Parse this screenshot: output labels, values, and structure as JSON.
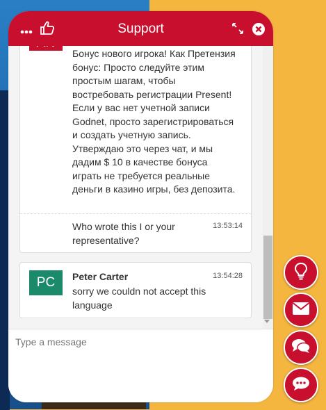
{
  "header": {
    "title": "Support"
  },
  "messages": [
    {
      "avatar": "AN",
      "avatar_color": "#c8102e",
      "text": "Бонус нового игрока! Как Претензия бонус: Просто следуйте этим простым шагам, чтобы востребовать регистрации Present! Если у вас нет учетной записи Godnet, просто зарегистрироваться и создать учетную запись. Утверждаю это через чат, и мы дадим $ 10 в качестве бонуса играть не требуется реальные деньги в казино игры, без депозита.",
      "followup_text": "Who wrote this I or your representative?",
      "followup_time": "13:53:14"
    },
    {
      "avatar": "PC",
      "avatar_color": "#1b8a6b",
      "name": "Peter Carter",
      "text": "sorry we couldn not accept this language",
      "time": "13:54:28"
    }
  ],
  "composer": {
    "placeholder": "Type a message"
  },
  "fabs": [
    "lightbulb-icon",
    "envelope-icon",
    "chat-bubbles-icon",
    "chat-icon"
  ],
  "colors": {
    "brand": "#c8102e",
    "page_bg": "#f4b63f"
  }
}
